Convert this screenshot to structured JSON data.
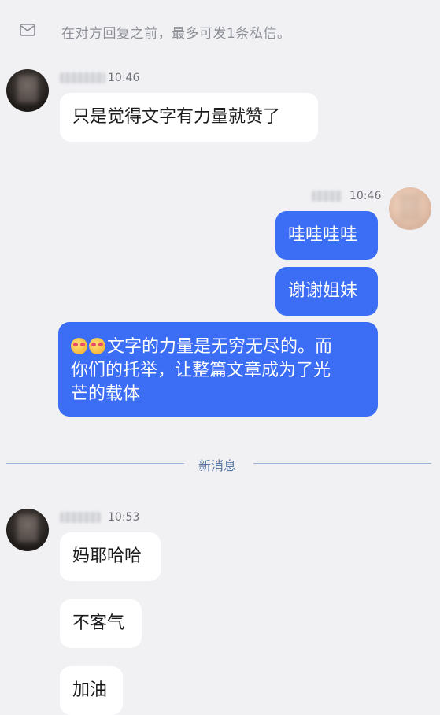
{
  "notice": {
    "text": "在对方回复之前，最多可发1条私信。"
  },
  "messages": {
    "m1": {
      "time": "10:46",
      "text": "只是觉得文字有力量就赞了"
    },
    "m2": {
      "time": "10:46",
      "text": "哇哇哇哇"
    },
    "m3": {
      "text": "谢谢姐妹"
    },
    "m4": {
      "line1": "文字的力量是无穷无尽的。而",
      "line2": "你们的托举，让整篇文章成为了光",
      "line3": "芒的载体"
    },
    "m5": {
      "time": "10:53",
      "text": "妈耶哈哈"
    },
    "m6": {
      "text": "不客气"
    },
    "m7": {
      "text": "加油"
    }
  },
  "divider": {
    "text": "新消息"
  },
  "icons": {
    "notice": "mail-icon",
    "emoji": "smiling-face-hearts-icon"
  },
  "colors": {
    "outgoing_bubble": "#3b6ef5",
    "incoming_bubble": "#ffffff",
    "background": "#f1f1f4"
  }
}
